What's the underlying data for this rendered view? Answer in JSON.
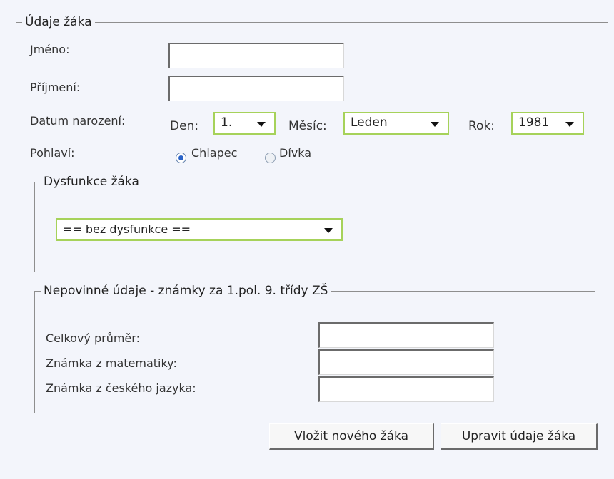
{
  "student": {
    "legend": "Údaje žáka",
    "first_name_label": "Jméno:",
    "first_name_value": "",
    "last_name_label": "Příjmení:",
    "last_name_value": "",
    "birth_date_label": "Datum narození:",
    "day_label": "Den:",
    "day_value": "1.",
    "month_label": "Měsíc:",
    "month_value": "Leden",
    "year_label": "Rok:",
    "year_value": "1981",
    "gender_label": "Pohlaví:",
    "gender_options": [
      "Chlapec",
      "Dívka"
    ],
    "gender_selected": "Chlapec"
  },
  "dysfunction": {
    "legend": "Dysfunkce žáka",
    "selected": "== bez dysfunkce =="
  },
  "optional": {
    "legend": "Nepovinné údaje - známky za 1.pol. 9. třídy ZŠ",
    "average_label": "Celkový průměr:",
    "math_label": "Známka z matematiky:",
    "czech_label": "Známka z českého jazyka:",
    "average_value": "",
    "math_value": "",
    "czech_value": ""
  },
  "actions": {
    "insert_label": "Vložit nového žáka",
    "edit_label": "Upravit údaje žáka"
  },
  "icons": {
    "dropdown": "chevron-down-icon",
    "radio": "radio-icon"
  },
  "colors": {
    "select_border": "#a6d25a",
    "background": "#f3f5fb",
    "radio_dot": "#2a63c8"
  }
}
